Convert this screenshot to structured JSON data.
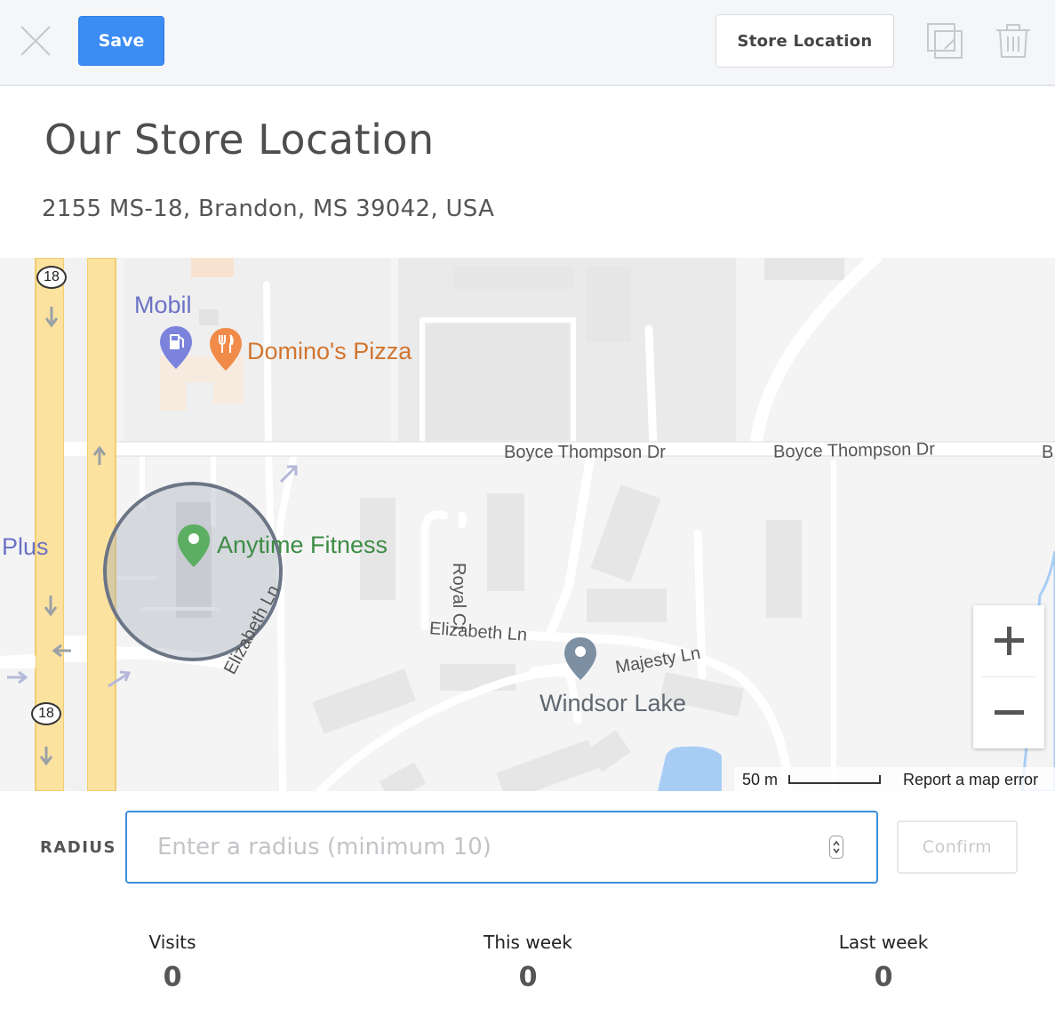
{
  "toolbar": {
    "save_label": "Save",
    "location_button_label": "Store Location",
    "close_icon": "close-icon",
    "duplicate_icon": "duplicate-icon",
    "delete_icon": "trash-icon"
  },
  "header": {
    "title": "Our Store Location",
    "address": "2155 MS-18, Brandon, MS 39042, USA"
  },
  "map": {
    "labels": {
      "mobil": "Mobil",
      "dominos": "Domino's Pizza",
      "anytime": "Anytime Fitness",
      "plus": "Plus",
      "windsor": "Windsor Lake",
      "boyce1": "Boyce Thompson Dr",
      "boyce2": "Boyce Thompson Dr",
      "boyce_edge": "B",
      "royal": "Royal Ct",
      "elizabeth1": "Elizabeth Ln",
      "elizabeth2": "Elizabeth Ln",
      "majesty": "Majesty Ln",
      "route1": "18",
      "route2": "18"
    },
    "zoom_in": "+",
    "zoom_out": "−",
    "scale_label": "50 m",
    "report_label": "Report a map error",
    "colors": {
      "highway": "#fbe29f",
      "highway_edge": "#f2cd72",
      "water": "#a8cdf5",
      "geofence_stroke": "#6b7585",
      "geofence_fill": "#9aa3b3"
    }
  },
  "radius": {
    "label": "RADIUS",
    "placeholder": "Enter a radius (minimum 10)",
    "value": "",
    "confirm_label": "Confirm"
  },
  "stats": [
    {
      "label": "Visits",
      "value": "0"
    },
    {
      "label": "This week",
      "value": "0"
    },
    {
      "label": "Last week",
      "value": "0"
    }
  ]
}
